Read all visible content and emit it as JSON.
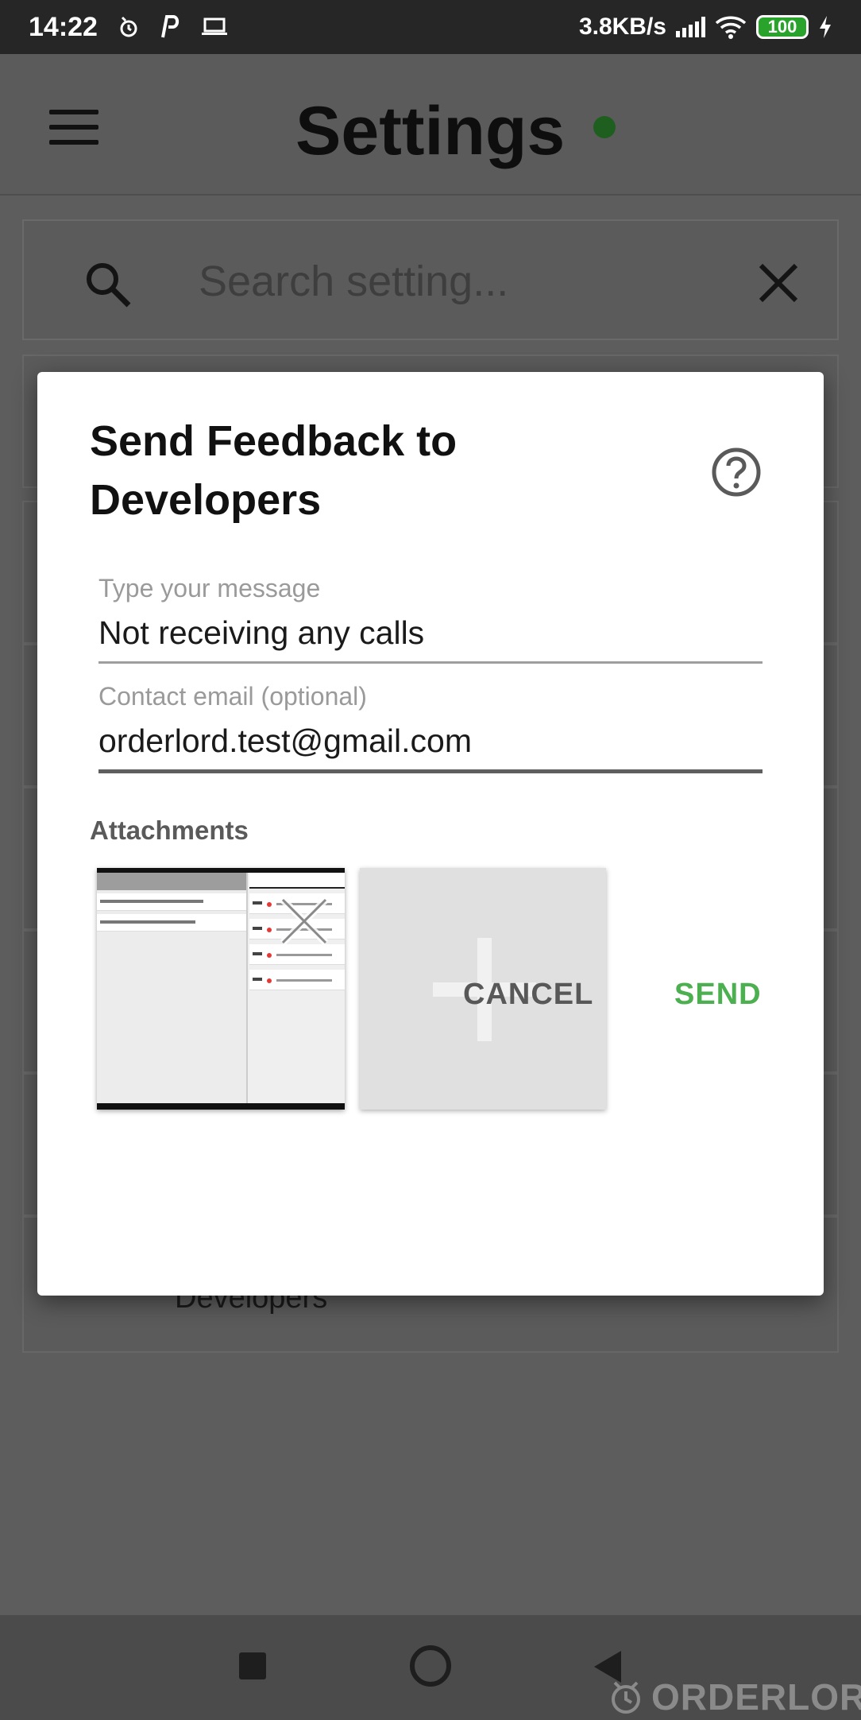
{
  "status_bar": {
    "time": "14:22",
    "network_speed": "3.8KB/s",
    "battery": "100",
    "icons": [
      "alarm-icon",
      "p-app-icon",
      "laptop-icon",
      "signal-icon",
      "wifi-icon",
      "battery-icon",
      "charging-icon"
    ]
  },
  "app_bar": {
    "title": "Settings",
    "status_color": "#1e5e1f"
  },
  "search": {
    "placeholder": "Search setting..."
  },
  "background": {
    "partial_item_label": "Developers"
  },
  "dialog": {
    "title": "Send Feedback to Developers",
    "message_label": "Type your message",
    "message_value": "Not receiving any calls",
    "email_label": "Contact email (optional)",
    "email_value": "orderlord.test@gmail.com",
    "attachments_label": "Attachments",
    "cancel_label": "CANCEL",
    "send_label": "SEND",
    "accent_color": "#4caf50"
  },
  "watermark": "ORDERLORD"
}
